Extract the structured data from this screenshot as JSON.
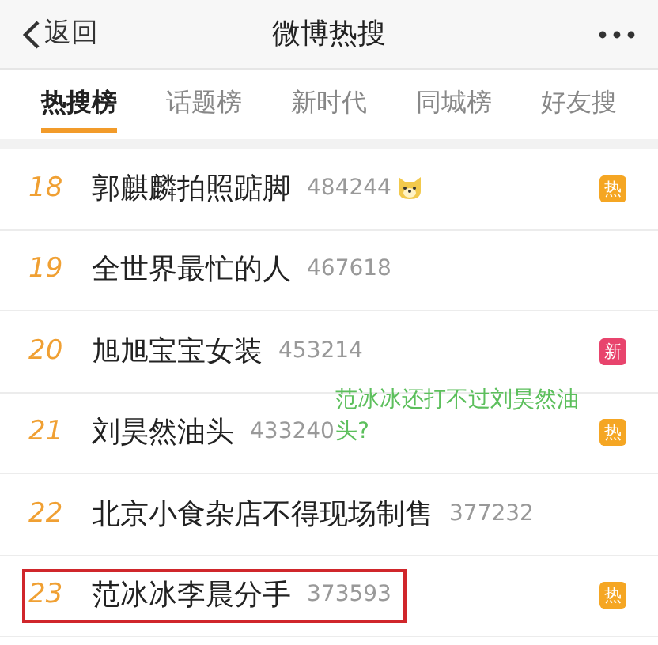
{
  "header": {
    "back_label": "返回",
    "title": "微博热搜"
  },
  "tabs": [
    {
      "label": "热搜榜",
      "selected": true
    },
    {
      "label": "话题榜",
      "selected": false
    },
    {
      "label": "新时代",
      "selected": false
    },
    {
      "label": "同城榜",
      "selected": false
    },
    {
      "label": "好友搜",
      "selected": false
    }
  ],
  "rows": [
    {
      "rank": "18",
      "title": "郭麒麟拍照踮脚",
      "count": "484244",
      "emoji": true,
      "badge": {
        "kind": "hot",
        "label": "热"
      },
      "highlighted": false
    },
    {
      "rank": "19",
      "title": "全世界最忙的人",
      "count": "467618",
      "emoji": false,
      "highlighted": false
    },
    {
      "rank": "20",
      "title": "旭旭宝宝女装",
      "count": "453214",
      "emoji": false,
      "badge": {
        "kind": "new",
        "label": "新"
      },
      "highlighted": false
    },
    {
      "rank": "21",
      "title": "刘昊然油头",
      "count": "433240",
      "emoji": false,
      "badge": {
        "kind": "hot",
        "label": "热"
      },
      "highlighted": false
    },
    {
      "rank": "22",
      "title": "北京小食杂店不得现场制售",
      "count": "377232",
      "emoji": false,
      "highlighted": false
    },
    {
      "rank": "23",
      "title": "范冰冰李晨分手",
      "count": "373593",
      "emoji": false,
      "badge": {
        "kind": "hot",
        "label": "热"
      },
      "highlighted": true
    }
  ],
  "annotation": {
    "text": "范冰冰还打不过刘昊然油头?"
  }
}
